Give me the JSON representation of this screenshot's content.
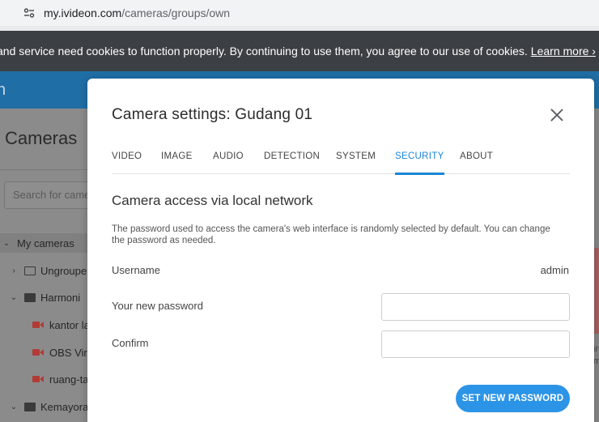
{
  "browser": {
    "url_host": "my.ivideon.com",
    "url_path": "/cameras/groups/own"
  },
  "cookie_banner": {
    "text": "and service need cookies to function properly. By continuing to use them, you agree to our use of cookies.",
    "link": "Learn more ›"
  },
  "background": {
    "header_fragment": "n",
    "page_title": "Cameras",
    "search_placeholder": "Search for came",
    "tree": [
      {
        "caret": "⌄",
        "label": "My cameras"
      },
      {
        "caret": "›",
        "label": "Ungroupe"
      },
      {
        "caret": "⌄",
        "label": "Harmoni"
      },
      {
        "label": "kantor la"
      },
      {
        "label": "OBS Virt"
      },
      {
        "label": "ruang-ta"
      },
      {
        "caret": "⌄",
        "label": "Kemayora"
      }
    ],
    "right_fragments": [
      "ir",
      "m"
    ]
  },
  "modal": {
    "title": "Camera settings: Gudang 01",
    "tabs": [
      "VIDEO",
      "IMAGE",
      "AUDIO",
      "DETECTION",
      "SYSTEM",
      "SECURITY",
      "ABOUT"
    ],
    "active_tab": "SECURITY",
    "section_title": "Camera access via local network",
    "description": "The password used to access the camera's web interface is randomly selected by default. You can change the password as needed.",
    "username_label": "Username",
    "username_value": "admin",
    "new_password_label": "Your new password",
    "new_password_value": "",
    "confirm_label": "Confirm",
    "confirm_value": "",
    "submit_label": "SET NEW PASSWORD"
  },
  "colors": {
    "accent": "#2c94e6",
    "active_tab": "#1a86d6",
    "camera_icon": "#b33b35",
    "cookie_bg": "#3c3f44",
    "header_bg": "#1f6ea5"
  }
}
